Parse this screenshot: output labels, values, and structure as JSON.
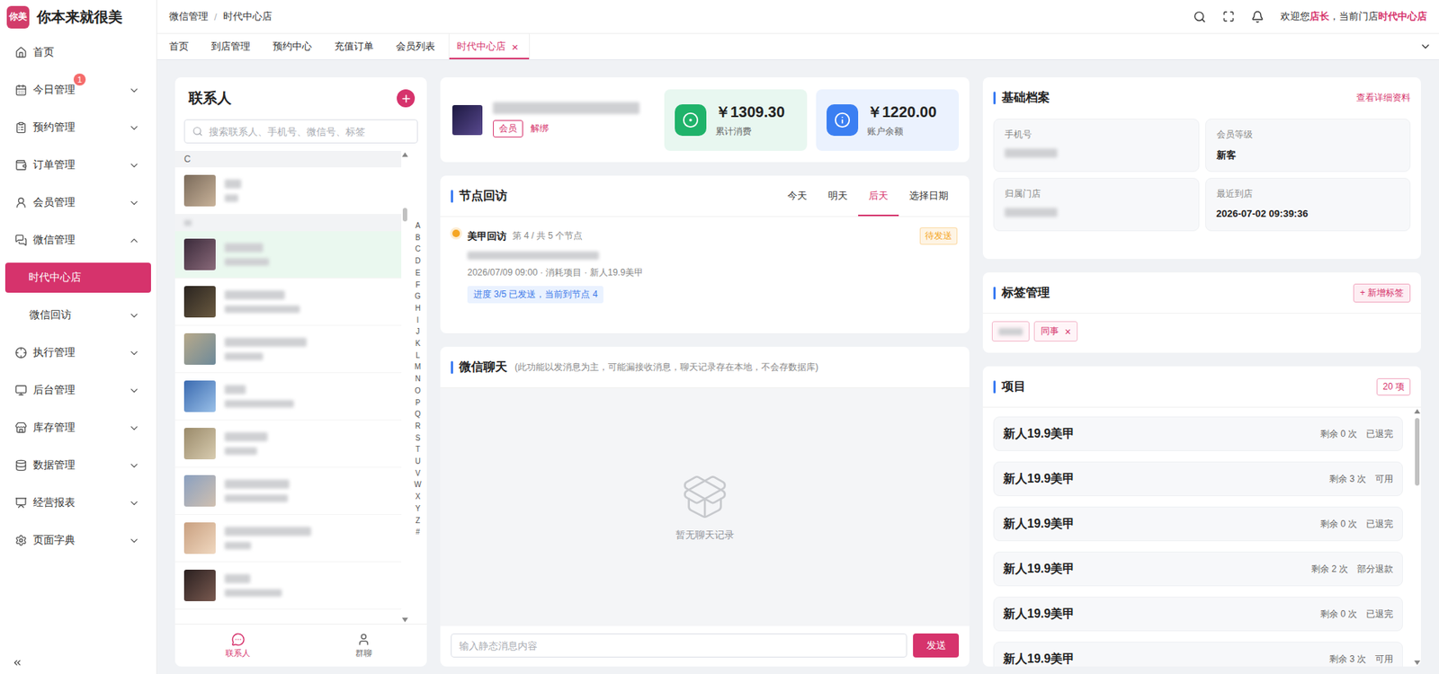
{
  "app": {
    "logo": "你美",
    "name": "你本来就很美"
  },
  "sidebar": {
    "items": [
      {
        "label": "首页",
        "expandable": false,
        "expanded": false,
        "selected": false
      },
      {
        "label": "今日管理",
        "expandable": true,
        "expanded": false,
        "selected": false,
        "badge": "1"
      },
      {
        "label": "预约管理",
        "expandable": true,
        "expanded": false,
        "selected": false
      },
      {
        "label": "订单管理",
        "expandable": true,
        "expanded": false,
        "selected": false
      },
      {
        "label": "会员管理",
        "expandable": true,
        "expanded": false,
        "selected": false
      },
      {
        "label": "微信管理",
        "expandable": true,
        "expanded": true,
        "selected": false,
        "children": [
          {
            "label": "时代中心店",
            "selected": true,
            "expandable": false,
            "expanded": false
          },
          {
            "label": "微信回访",
            "selected": false,
            "expandable": true,
            "expanded": false
          }
        ]
      },
      {
        "label": "执行管理",
        "expandable": true,
        "expanded": false,
        "selected": false
      },
      {
        "label": "后台管理",
        "expandable": true,
        "expanded": false,
        "selected": false
      },
      {
        "label": "库存管理",
        "expandable": true,
        "expanded": false,
        "selected": false
      },
      {
        "label": "数据管理",
        "expandable": true,
        "expanded": false,
        "selected": false
      },
      {
        "label": "经营报表",
        "expandable": true,
        "expanded": false,
        "selected": false
      },
      {
        "label": "页面字典",
        "expandable": true,
        "expanded": false,
        "selected": false
      }
    ]
  },
  "header": {
    "breadcrumb": [
      "微信管理",
      "时代中心店"
    ],
    "separator": "/",
    "welcome": {
      "prefix": "欢迎您",
      "role": "店长",
      "middle": "，当前门店",
      "store": "时代中心店"
    }
  },
  "tabs": [
    {
      "label": "首页",
      "selected": false
    },
    {
      "label": "到店管理",
      "selected": false
    },
    {
      "label": "预约中心",
      "selected": false
    },
    {
      "label": "充值订单",
      "selected": false
    },
    {
      "label": "会员列表",
      "selected": false
    },
    {
      "label": "时代中心店",
      "selected": true,
      "close": "×"
    }
  ],
  "contacts": {
    "title": "联系人",
    "search_placeholder": "搜索联系人、手机号、微信号、标签",
    "list": [
      {
        "kind": "header",
        "label": "C"
      },
      {
        "kind": "contact",
        "selected": false
      },
      {
        "kind": "masked"
      },
      {
        "kind": "contact",
        "selected": true
      },
      {
        "kind": "contact",
        "selected": false
      },
      {
        "kind": "contact",
        "selected": false
      },
      {
        "kind": "contact",
        "selected": false
      },
      {
        "kind": "contact",
        "selected": false
      },
      {
        "kind": "contact",
        "selected": false
      },
      {
        "kind": "contact",
        "selected": false
      },
      {
        "kind": "contact",
        "selected": false
      }
    ],
    "index": [
      "A",
      "B",
      "C",
      "D",
      "E",
      "F",
      "G",
      "H",
      "I",
      "J",
      "K",
      "L",
      "M",
      "N",
      "O",
      "P",
      "Q",
      "R",
      "S",
      "T",
      "U",
      "V",
      "W",
      "X",
      "Y",
      "Z",
      "#"
    ],
    "bottom_tabs": [
      {
        "label": "联系人",
        "selected": true
      },
      {
        "label": "群聊",
        "selected": false
      }
    ]
  },
  "profile": {
    "tag": "会员",
    "unbind": "解绑",
    "stats": [
      {
        "value": "￥1309.30",
        "label": "累计消费",
        "color": "#1fb36a"
      },
      {
        "value": "￥1220.00",
        "label": "账户余额",
        "color": "#3b7ff2"
      }
    ]
  },
  "followup": {
    "title": "节点回访",
    "days": [
      {
        "label": "今天",
        "selected": false
      },
      {
        "label": "明天",
        "selected": false
      },
      {
        "label": "后天",
        "selected": true
      },
      {
        "label": "选择日期",
        "selected": false
      }
    ],
    "items": [
      {
        "title": "美甲回访",
        "node": "第 4 / 共 5 个节点",
        "status": "待发送",
        "meta": "2026/07/09 09:00 · 消耗项目 · 新人19.9美甲",
        "progress": "进度 3/5 已发送，当前到节点 4",
        "color": "#f5a623"
      }
    ]
  },
  "chat": {
    "title": "微信聊天",
    "note": "(此功能以发消息为主，可能漏接收消息，聊天记录存在本地，不会存数据库)",
    "empty": "暂无聊天记录",
    "input_placeholder": "输入静态消息内容",
    "send": "发送"
  },
  "basic": {
    "title": "基础档案",
    "link": "查看详细资料",
    "fields": [
      {
        "label": "手机号",
        "masked": true
      },
      {
        "label": "会员等级",
        "value": "新客",
        "masked": false
      },
      {
        "label": "归属门店",
        "masked": true
      },
      {
        "label": "最近到店",
        "value": "2026-07-02 09:39:36",
        "masked": false
      }
    ]
  },
  "tags": {
    "title": "标签管理",
    "add": "+ 新增标签",
    "items": [
      {
        "masked": true
      },
      {
        "masked": false,
        "label": "同事",
        "remove": "×"
      }
    ]
  },
  "projects": {
    "title": "项目",
    "count": "20 项",
    "items": [
      {
        "name": "新人19.9美甲",
        "remaining": "剩余 0 次",
        "status": "已退完"
      },
      {
        "name": "新人19.9美甲",
        "remaining": "剩余 3 次",
        "status": "可用"
      },
      {
        "name": "新人19.9美甲",
        "remaining": "剩余 0 次",
        "status": "已退完"
      },
      {
        "name": "新人19.9美甲",
        "remaining": "剩余 2 次",
        "status": "部分退款"
      },
      {
        "name": "新人19.9美甲",
        "remaining": "剩余 0 次",
        "status": "已退完"
      },
      {
        "name": "新人19.9美甲",
        "remaining": "剩余 3 次",
        "status": "可用"
      }
    ]
  }
}
